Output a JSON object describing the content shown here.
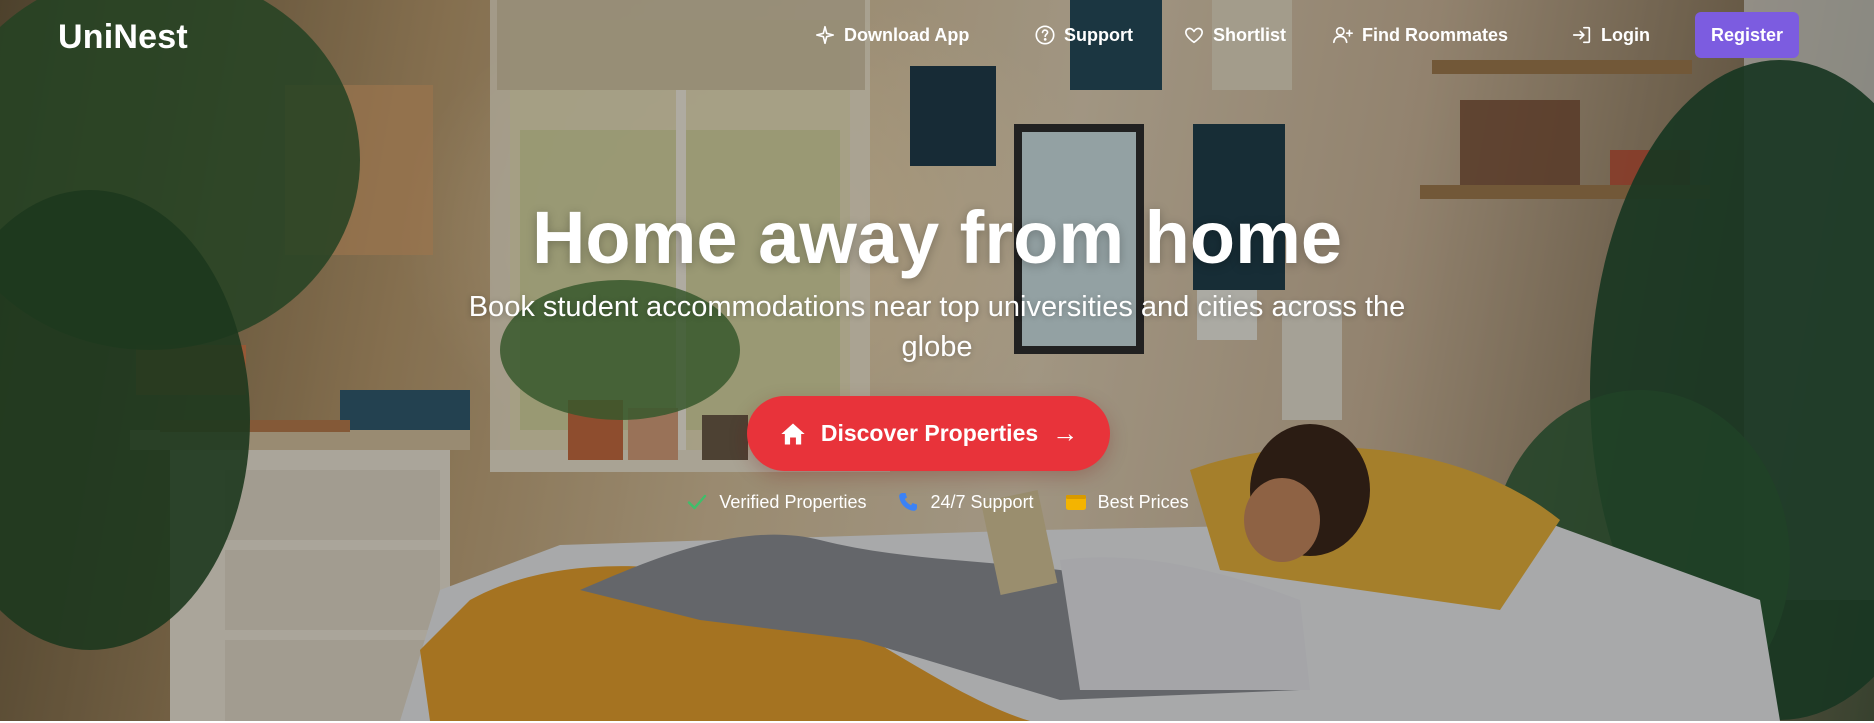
{
  "brand": {
    "name": "UniNest"
  },
  "nav": {
    "download_app": "Download App",
    "support": "Support",
    "shortlist": "Shortlist",
    "find_roommates": "Find Roommates",
    "login": "Login",
    "register": "Register"
  },
  "hero": {
    "title": "Home away from home",
    "subtitle": "Book student accommodations near top universities and cities across the globe",
    "cta_label": "Discover Properties",
    "cta_arrow": "→",
    "features": [
      {
        "label": "Verified Properties",
        "icon": "check-icon",
        "color": "#3fbf6a"
      },
      {
        "label": "24/7 Support",
        "icon": "phone-icon",
        "color": "#3b82f6"
      },
      {
        "label": "Best Prices",
        "icon": "wallet-icon",
        "color": "#f4b400"
      }
    ]
  },
  "colors": {
    "register_bg": "#7c5ce0",
    "cta_bg": "#e8333a"
  }
}
